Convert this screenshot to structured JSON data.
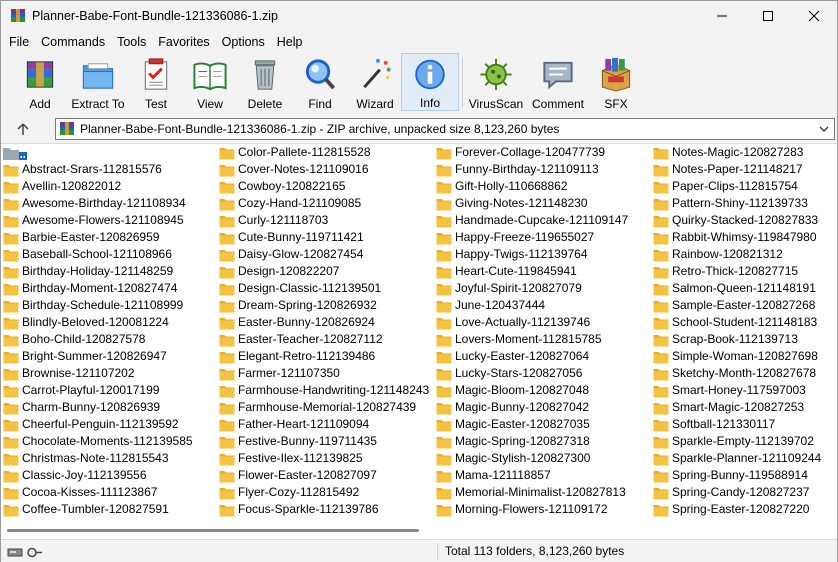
{
  "window": {
    "title": "Planner-Babe-Font-Bundle-121336086-1.zip"
  },
  "menu": [
    "File",
    "Commands",
    "Tools",
    "Favorites",
    "Options",
    "Help"
  ],
  "toolbar": [
    {
      "label": "Add",
      "icon": "add-icon"
    },
    {
      "label": "Extract To",
      "icon": "extract-icon"
    },
    {
      "label": "Test",
      "icon": "test-icon"
    },
    {
      "label": "View",
      "icon": "view-icon"
    },
    {
      "label": "Delete",
      "icon": "delete-icon"
    },
    {
      "label": "Find",
      "icon": "find-icon"
    },
    {
      "label": "Wizard",
      "icon": "wizard-icon"
    },
    {
      "label": "Info",
      "icon": "info-icon"
    },
    {
      "label": "VirusScan",
      "icon": "virusscan-icon"
    },
    {
      "label": "Comment",
      "icon": "comment-icon"
    },
    {
      "label": "SFX",
      "icon": "sfx-icon"
    }
  ],
  "address": {
    "text": "Planner-Babe-Font-Bundle-121336086-1.zip - ZIP archive, unpacked size 8,123,260 bytes"
  },
  "files": {
    "col1": [
      "Abstract-Srars-112815576",
      "Avellin-120822012",
      "Awesome-Birthday-121108934",
      "Awesome-Flowers-121108945",
      "Barbie-Easter-120826959",
      "Baseball-School-121108966",
      "Birthday-Holiday-121148259",
      "Birthday-Moment-120827474",
      "Birthday-Schedule-121108999",
      "Blindly-Beloved-120081224",
      "Boho-Child-120827578",
      "Bright-Summer-120826947",
      "Brownise-121107202",
      "Carrot-Playful-120017199",
      "Charm-Bunny-120826939",
      "Cheerful-Penguin-112139592",
      "Chocolate-Moments-112139585",
      "Christmas-Note-112815543",
      "Classic-Joy-112139556",
      "Cocoa-Kisses-111123867",
      "Coffee-Tumbler-120827591"
    ],
    "col2": [
      "Color-Pallete-112815528",
      "Cover-Notes-121109016",
      "Cowboy-120822165",
      "Cozy-Hand-121109085",
      "Curly-121118703",
      "Cute-Bunny-119711421",
      "Daisy-Glow-120827454",
      "Design-120822207",
      "Design-Classic-112139501",
      "Dream-Spring-120826932",
      "Easter-Bunny-120826924",
      "Easter-Teacher-120827112",
      "Elegant-Retro-112139486",
      "Farmer-121107350",
      "Farmhouse-Handwriting-121148243",
      "Farmhouse-Memorial-120827439",
      "Father-Heart-121109094",
      "Festive-Bunny-119711435",
      "Festive-Ilex-112139825",
      "Flower-Easter-120827097",
      "Flyer-Cozy-112815492",
      "Focus-Sparkle-112139786"
    ],
    "col3": [
      "Forever-Collage-120477739",
      "Funny-Birthday-121109113",
      "Gift-Holly-110668862",
      "Giving-Notes-121148230",
      "Handmade-Cupcake-121109147",
      "Happy-Freeze-119655027",
      "Happy-Twigs-112139764",
      "Heart-Cute-119845941",
      "Joyful-Spirit-120827079",
      "June-120437444",
      "Love-Actually-112139746",
      "Lovers-Moment-112815785",
      "Lucky-Easter-120827064",
      "Lucky-Stars-120827056",
      "Magic-Bloom-120827048",
      "Magic-Bunny-120827042",
      "Magic-Easter-120827035",
      "Magic-Spring-120827318",
      "Magic-Stylish-120827300",
      "Mama-121118857",
      "Memorial-Minimalist-120827813",
      "Morning-Flowers-121109172"
    ],
    "col4": [
      "Notes-Magic-120827283",
      "Notes-Paper-121148217",
      "Paper-Clips-112815754",
      "Pattern-Shiny-112139733",
      "Quirky-Stacked-120827833",
      "Rabbit-Whimsy-119847980",
      "Rainbow-120821312",
      "Retro-Thick-120827715",
      "Salmon-Queen-121148191",
      "Sample-Easter-120827268",
      "School-Student-121148183",
      "Scrap-Book-112139713",
      "Simple-Woman-120827698",
      "Sketchy-Month-120827678",
      "Smart-Honey-117597003",
      "Smart-Magic-120827253",
      "Softball-121330117",
      "Sparkle-Empty-112139702",
      "Sparkle-Planner-121109244",
      "Spring-Bunny-119588914",
      "Spring-Candy-120827237",
      "Spring-Easter-120827220"
    ]
  },
  "status": {
    "text": "Total 113 folders, 8,123,260 bytes"
  },
  "colors": {
    "folder": "#f5c342",
    "selection": "#e1ecf7",
    "accent": "#1e62c8"
  }
}
